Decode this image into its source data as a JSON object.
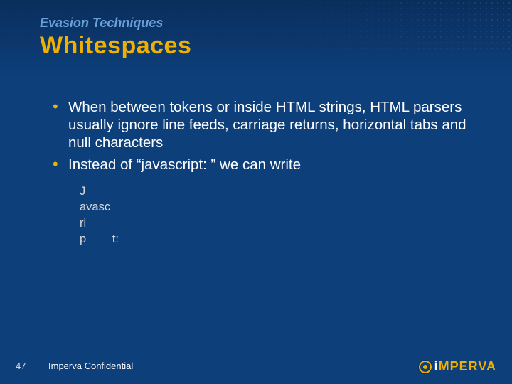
{
  "header": {
    "eyebrow": "Evasion Techniques",
    "title": "Whitespaces"
  },
  "bullets": [
    "When between tokens or inside HTML strings, HTML parsers usually ignore line feeds, carriage returns, horizontal tabs and null characters",
    "Instead of “javascript: ” we can write"
  ],
  "code": "J\navasc\nri\np        t:",
  "footer": {
    "page": "47",
    "confidential": "Imperva Confidential",
    "logo_white": "i",
    "logo_orange": "MPERVA"
  }
}
